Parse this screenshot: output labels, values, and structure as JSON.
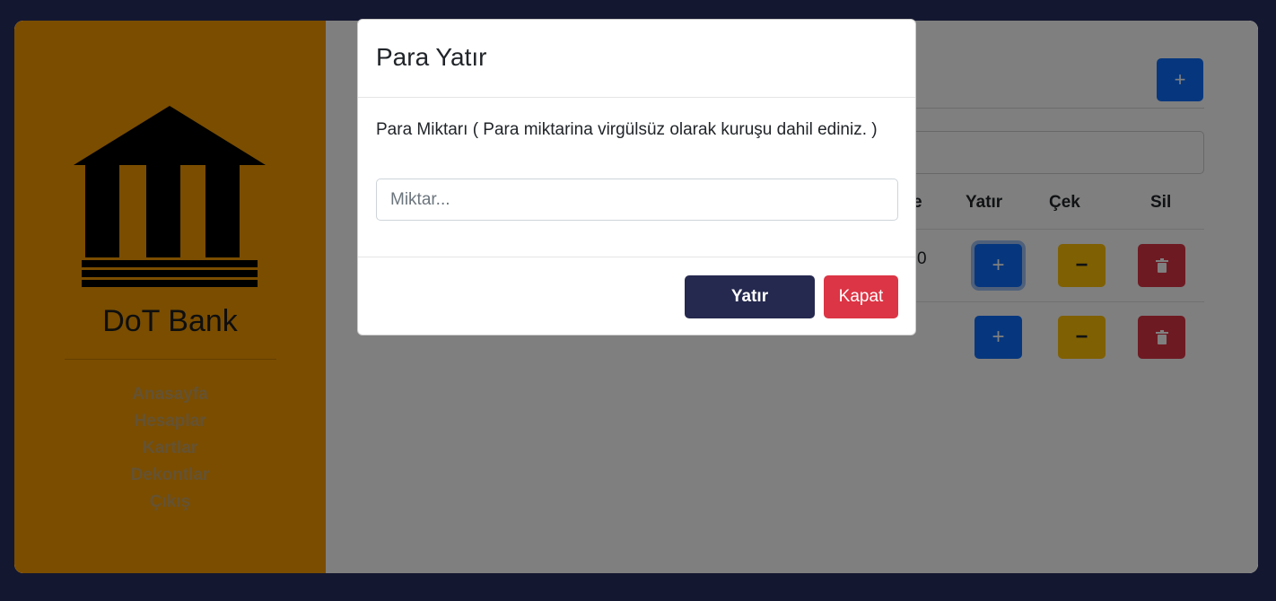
{
  "sidebar": {
    "brand": "DoT Bank",
    "nav": [
      "Anasayfa",
      "Hesaplar",
      "Kartlar",
      "Dekontlar",
      "Çıkış"
    ]
  },
  "main": {
    "add_label": "+",
    "table": {
      "headers": {
        "partial_col": "e",
        "deposit": "Yatır",
        "withdraw": "Çek",
        "delete": "Sil"
      },
      "rows": [
        {
          "partial_value": "0"
        },
        {
          "partial_value": ""
        }
      ]
    },
    "icons": {
      "plus": "+",
      "minus": "−"
    }
  },
  "modal": {
    "title": "Para Yatır",
    "label": "Para Miktarı ( Para miktarina virgülsüz olarak kuruşu dahil ediniz. )",
    "input_placeholder": "Miktar...",
    "input_value": "",
    "submit_label": "Yatır",
    "close_label": "Kapat"
  },
  "colors": {
    "sidebar": "#f59a00",
    "submit": "#25294f",
    "danger": "#dc3545",
    "primary": "#0d6efd",
    "warning": "#ffc107"
  }
}
